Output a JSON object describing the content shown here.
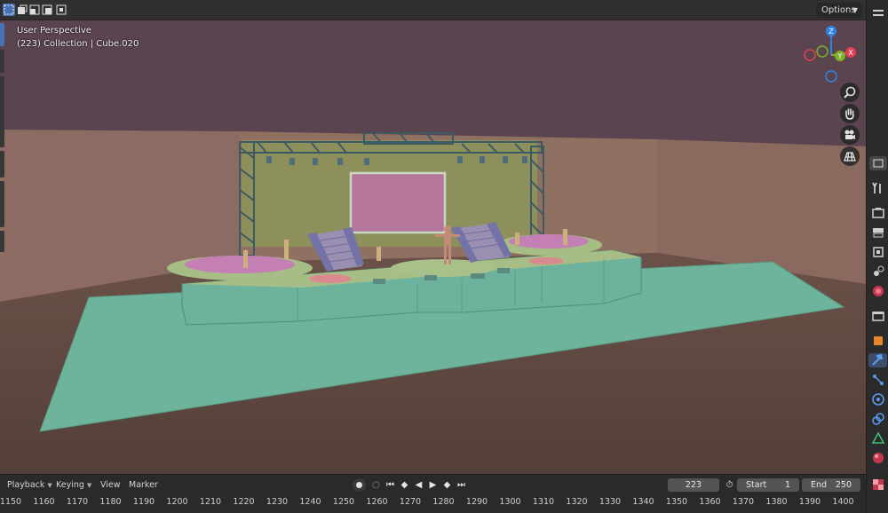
{
  "viewport": {
    "view_name": "User Perspective",
    "collection_info": "(223) Collection | Cube.020",
    "options_label": "Options"
  },
  "header": {
    "select_modes": [
      "select-box-icon",
      "select-extend-icon",
      "select-subtract-icon",
      "select-invert-icon",
      "select-intersect-icon"
    ]
  },
  "gizmo": {
    "x_label": "X",
    "y_label": "Y",
    "z_label": "Z",
    "colors": {
      "x": "#e0414f",
      "y": "#7fb02a",
      "z": "#2f84e3"
    }
  },
  "nav_buttons": [
    "zoom-icon",
    "hand-pan-icon",
    "camera-icon",
    "grid-ortho-icon"
  ],
  "properties_tabs": [
    "tool-icon",
    "render-icon",
    "output-icon",
    "view-layer-icon",
    "scene-icon",
    "world-icon",
    "collection-icon",
    "object-icon",
    "modifier-icon",
    "particles-icon",
    "physics-icon",
    "constraints-icon",
    "data-icon",
    "material-icon",
    "texture-icon"
  ],
  "timeline": {
    "menus": [
      {
        "label": "Playback",
        "has_dropdown": true
      },
      {
        "label": "Keying",
        "has_dropdown": true
      },
      {
        "label": "View",
        "has_dropdown": false
      },
      {
        "label": "Marker",
        "has_dropdown": false
      }
    ],
    "current_frame": "223",
    "start_label": "Start",
    "start_value": "1",
    "end_label": "End",
    "end_value": "250",
    "ruler_ticks": [
      "1150",
      "1160",
      "1170",
      "1180",
      "1190",
      "1200",
      "1210",
      "1220",
      "1230",
      "1240",
      "1250",
      "1260",
      "1270",
      "1280",
      "1290",
      "1300",
      "1310",
      "1320",
      "1330",
      "1340",
      "1350",
      "1360",
      "1370",
      "1380",
      "1390",
      "1400"
    ]
  },
  "colors": {
    "ceiling": "#59444f",
    "wall": "#8a6a62",
    "floor": "#5c4840",
    "stage_green": "#6bb59b",
    "stage_top": "#a7bf86",
    "screen": "#b7779a",
    "backdrop": "#8a8f5a"
  }
}
